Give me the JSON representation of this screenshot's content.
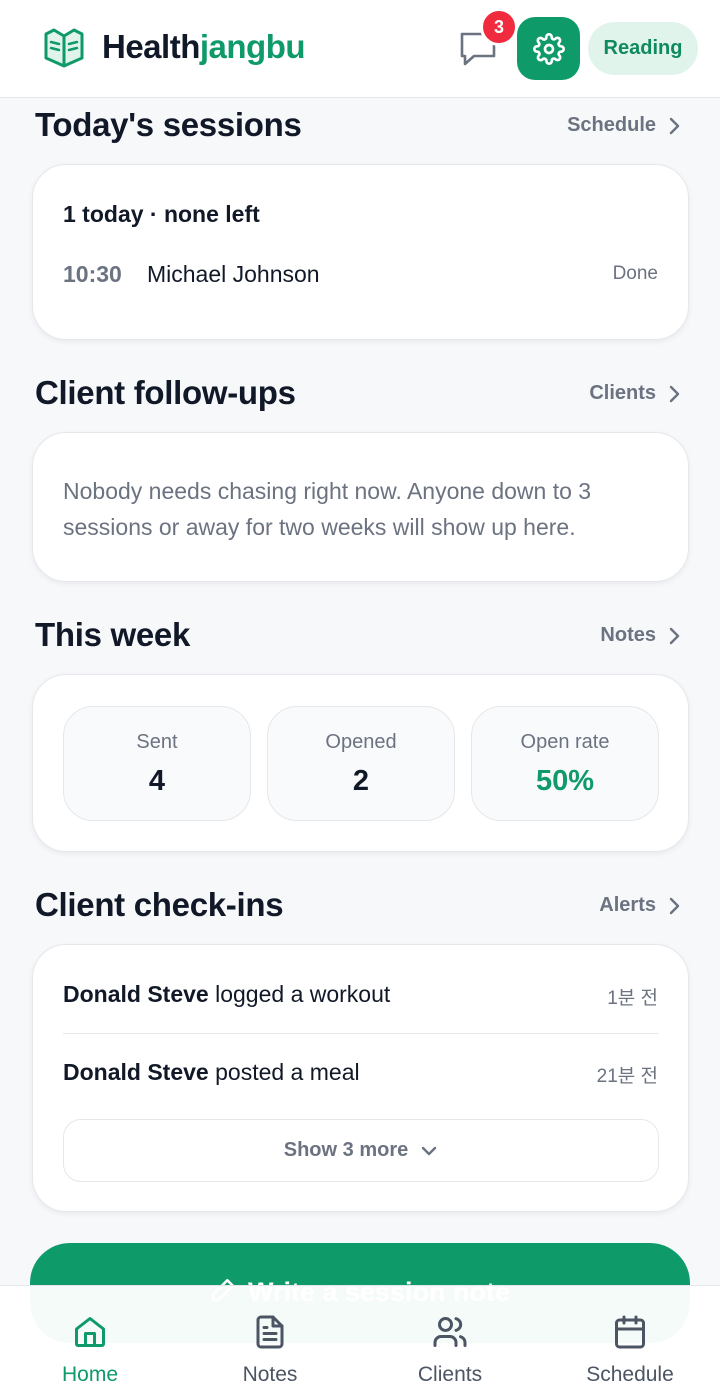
{
  "header": {
    "brand_part1": "Health",
    "brand_part2": "jangbu",
    "messages_badge": "3",
    "reading_label": "Reading"
  },
  "sessions": {
    "title": "Today's sessions",
    "link": "Schedule",
    "summary": "1 today · none left",
    "items": [
      {
        "time": "10:30",
        "name": "Michael Johnson",
        "status": "Done"
      }
    ]
  },
  "followups": {
    "title": "Client follow-ups",
    "link": "Clients",
    "empty_text": "Nobody needs chasing right now. Anyone down to 3 sessions or away for two weeks will show up here."
  },
  "week": {
    "title": "This week",
    "link": "Notes",
    "stats": [
      {
        "label": "Sent",
        "value": "4"
      },
      {
        "label": "Opened",
        "value": "2"
      },
      {
        "label": "Open rate",
        "value": "50%"
      }
    ]
  },
  "checkins": {
    "title": "Client check-ins",
    "link": "Alerts",
    "items": [
      {
        "name": "Donald Steve",
        "action": " logged a workout",
        "time": "1분 전"
      },
      {
        "name": "Donald Steve",
        "action": " posted a meal",
        "time": "21분 전"
      }
    ],
    "show_more": "Show 3 more"
  },
  "cta": {
    "label": "Write a session note"
  },
  "nav": {
    "items": [
      {
        "label": "Home",
        "icon": "home-icon",
        "active": true
      },
      {
        "label": "Notes",
        "icon": "document-icon",
        "active": false
      },
      {
        "label": "Clients",
        "icon": "users-icon",
        "active": false
      },
      {
        "label": "Schedule",
        "icon": "calendar-icon",
        "active": false
      }
    ]
  },
  "colors": {
    "accent": "#0f9a6a",
    "badge": "#ef2b3d",
    "muted_text": "#6b7280",
    "background": "#f6f8fa"
  }
}
